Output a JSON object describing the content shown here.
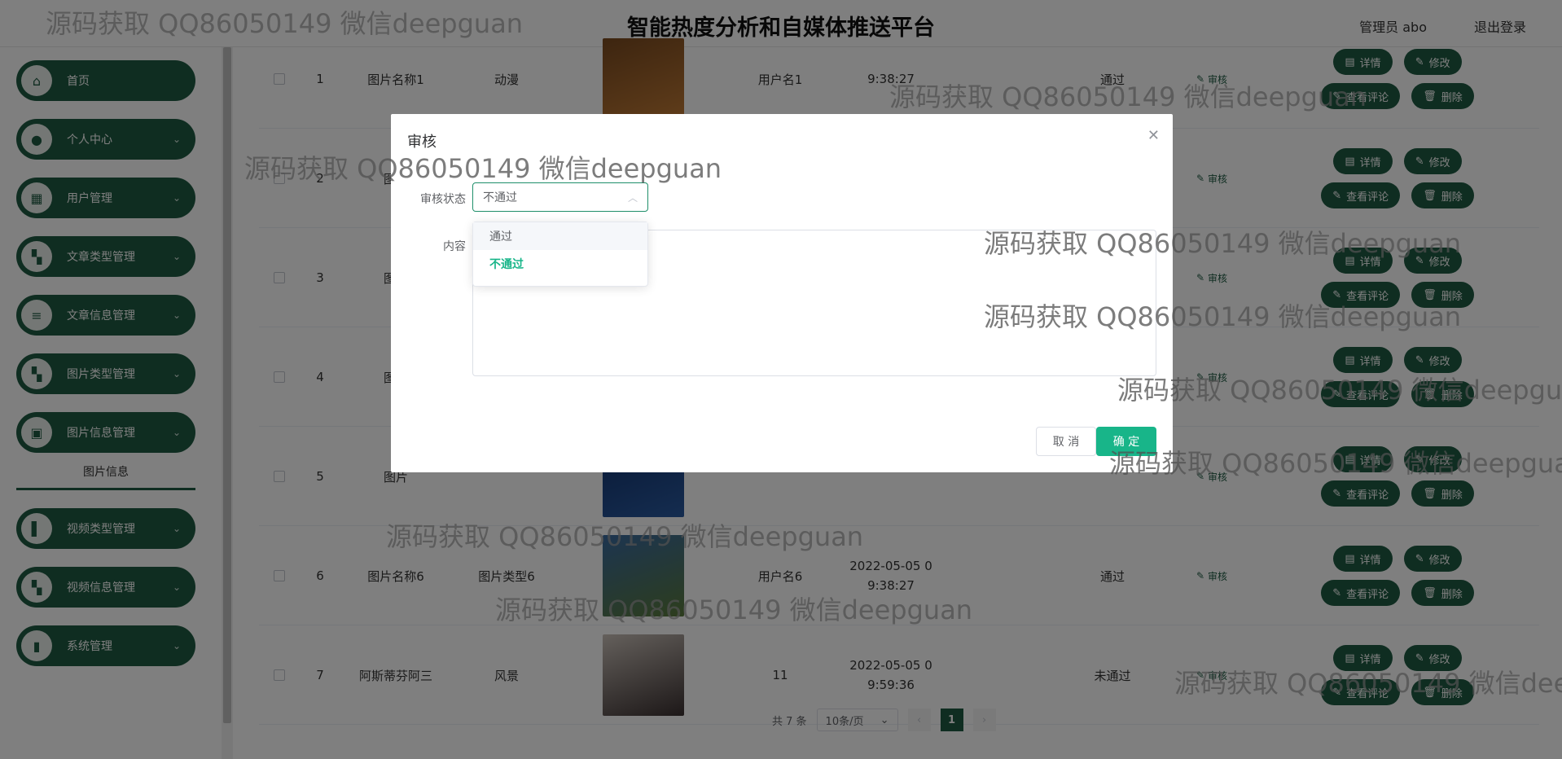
{
  "header": {
    "title": "智能热度分析和自媒体推送平台",
    "admin": "管理员 abo",
    "logout": "退出登录"
  },
  "sidebar": {
    "items": [
      {
        "label": "首页",
        "icon": "home-icon",
        "glyph": "⌂"
      },
      {
        "label": "个人中心",
        "icon": "user-icon",
        "glyph": "●"
      },
      {
        "label": "用户管理",
        "icon": "chart-icon",
        "glyph": "▦"
      },
      {
        "label": "文章类型管理",
        "icon": "grid-icon",
        "glyph": "▚"
      },
      {
        "label": "文章信息管理",
        "icon": "list-icon",
        "glyph": "≡"
      },
      {
        "label": "图片类型管理",
        "icon": "grid-icon",
        "glyph": "▚"
      },
      {
        "label": "图片信息管理",
        "icon": "clipboard-icon",
        "glyph": "▣"
      },
      {
        "label": "视频类型管理",
        "icon": "book-icon",
        "glyph": "▌"
      },
      {
        "label": "视频信息管理",
        "icon": "grid-icon",
        "glyph": "▚"
      },
      {
        "label": "系统管理",
        "icon": "bar-chart-icon",
        "glyph": "▮"
      }
    ],
    "sub_item": "图片信息"
  },
  "table": {
    "rows": [
      {
        "idx": "1",
        "name": "图片名称1",
        "type": "动漫",
        "user": "用户名1",
        "time_a": "",
        "time_b": "9:38:27",
        "status": "通过",
        "img": [
          "#7a4a20",
          "#c07a35"
        ]
      },
      {
        "idx": "2",
        "name": "图片",
        "type": "",
        "user": "",
        "time_a": "",
        "time_b": "",
        "status": "",
        "img": [
          "#d4a070",
          "#8b6040"
        ]
      },
      {
        "idx": "3",
        "name": "图片",
        "type": "",
        "user": "",
        "time_a": "",
        "time_b": "",
        "status": "",
        "img": [
          "#4a6a8a",
          "#8aa0b0"
        ]
      },
      {
        "idx": "4",
        "name": "图片",
        "type": "",
        "user": "",
        "time_a": "",
        "time_b": "",
        "status": "",
        "img": [
          "#b5a08a",
          "#6a7a8a"
        ]
      },
      {
        "idx": "5",
        "name": "图片",
        "type": "",
        "user": "",
        "time_a": "",
        "time_b": "",
        "status": "",
        "img": [
          "#10306a",
          "#2a5aa0"
        ]
      },
      {
        "idx": "6",
        "name": "图片名称6",
        "type": "图片类型6",
        "user": "用户名6",
        "time_a": "2022-05-05 0",
        "time_b": "9:38:27",
        "status": "通过",
        "img": [
          "#3a6aa0",
          "#5a7a3a"
        ]
      },
      {
        "idx": "7",
        "name": "阿斯蒂芬阿三",
        "type": "风景",
        "user": "11",
        "time_a": "2022-05-05 0",
        "time_b": "9:59:36",
        "status": "未通过",
        "img": [
          "#c9c0b8",
          "#3a3030"
        ]
      }
    ],
    "audit_label": "审核",
    "btn_detail": "详情",
    "btn_edit": "修改",
    "btn_comment": "查看评论",
    "btn_delete": "删除"
  },
  "pager": {
    "total": "共 7 条",
    "size": "10条/页",
    "prev": "‹",
    "next": "›",
    "current": "1"
  },
  "dialog": {
    "title": "审核",
    "status_label": "审核状态",
    "status_value": "不通过",
    "content_label": "内容",
    "cancel": "取 消",
    "ok": "确 定",
    "options": [
      "通过",
      "不通过"
    ]
  },
  "watermark": "源码获取 QQ86050149 微信deepguan",
  "colors": {
    "primary": "#1f5a42",
    "accent": "#18b589"
  }
}
